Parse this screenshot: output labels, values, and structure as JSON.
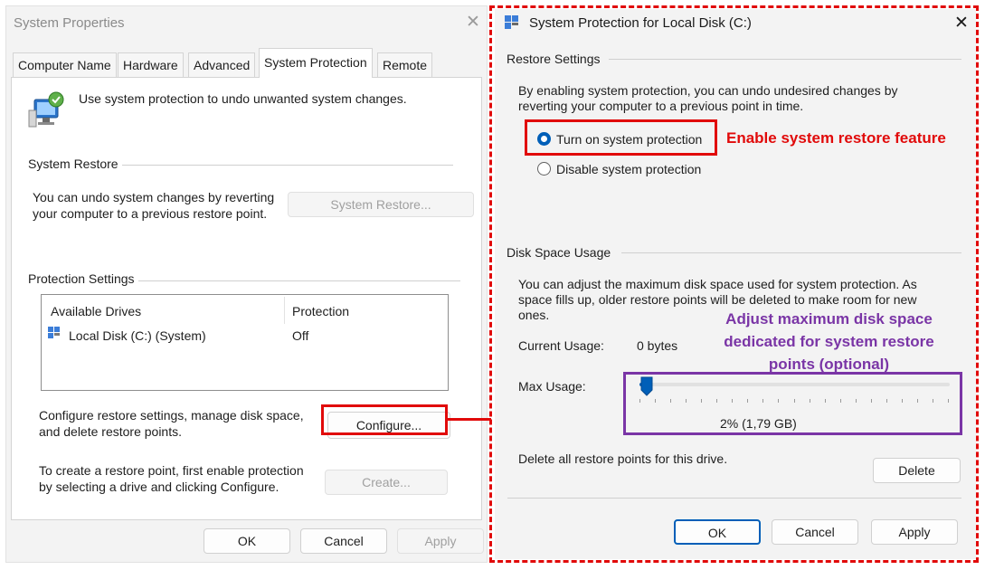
{
  "system_properties": {
    "title": "System Properties",
    "close_glyph": "✕",
    "tabs": [
      "Computer Name",
      "Hardware",
      "Advanced",
      "System Protection",
      "Remote"
    ],
    "active_tab": "System Protection",
    "intro": "Use system protection to undo unwanted system changes.",
    "system_restore": {
      "group_label": "System Restore",
      "text_line1": "You can undo system changes by reverting",
      "text_line2": "your computer to a previous restore point.",
      "button": "System Restore..."
    },
    "protection_settings": {
      "group_label": "Protection Settings",
      "columns": [
        "Available Drives",
        "Protection"
      ],
      "rows": [
        {
          "drive": "Local Disk (C:) (System)",
          "protection": "Off"
        }
      ],
      "configure_text_line1": "Configure restore settings, manage disk space,",
      "configure_text_line2": "and delete restore points.",
      "configure_button": "Configure...",
      "create_text_line1": "To create a restore point, first enable protection",
      "create_text_line2": "by selecting a drive and clicking Configure.",
      "create_button": "Create..."
    },
    "buttons": {
      "ok": "OK",
      "cancel": "Cancel",
      "apply": "Apply"
    }
  },
  "system_protection": {
    "title": "System Protection for Local Disk (C:)",
    "close_glyph": "✕",
    "restore_settings": {
      "group_label": "Restore Settings",
      "text_line1": "By enabling system protection, you can undo undesired changes by",
      "text_line2": "reverting your computer to a previous point in time.",
      "radio_on": "Turn on system protection",
      "radio_off": "Disable system protection",
      "selected": "Turn on system protection"
    },
    "disk_space": {
      "group_label": "Disk Space Usage",
      "text_line1": "You can adjust the maximum disk space used for system protection. As",
      "text_line2": "space fills up, older restore points will be deleted to make room for new",
      "text_line3": "ones.",
      "current_usage_label": "Current Usage:",
      "current_usage_value": "0 bytes",
      "max_usage_label": "Max Usage:",
      "max_usage_percent": 2,
      "max_usage_readout": "2% (1,79 GB)",
      "delete_text": "Delete all restore points for this drive.",
      "delete_button": "Delete"
    },
    "buttons": {
      "ok": "OK",
      "cancel": "Cancel",
      "apply": "Apply"
    }
  },
  "annotations": {
    "enable_note": "Enable system restore feature",
    "adjust_note_line1": "Adjust maximum disk space",
    "adjust_note_line2": "dedicated for system restore",
    "adjust_note_line3": "points (optional)",
    "colors": {
      "red": "#e10a0a",
      "purple": "#7a35a6",
      "accent": "#005fb8"
    }
  }
}
